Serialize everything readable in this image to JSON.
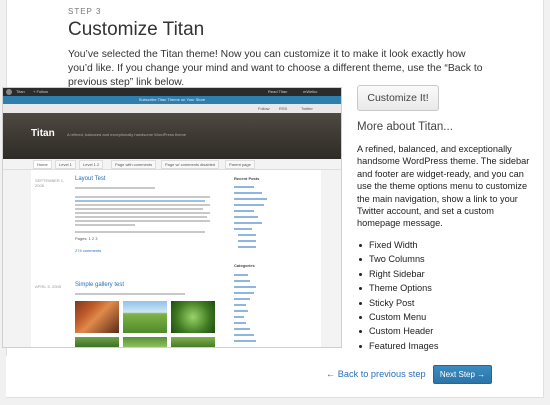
{
  "step": {
    "label": "STEP 3"
  },
  "title": "Customize Titan",
  "intro": "You’ve selected the Titan theme! Now you can customize it to make it look exactly how you’d like. If you change your mind and want to choose a different theme, use the “Back to previous step” link below.",
  "preview": {
    "adminbar": {
      "site": "Titan",
      "new": "+ Follow",
      "right1": "Read Titan",
      "right2": "mWelko"
    },
    "notice": "Subscribe Titan Theme on Your Store",
    "social": [
      "Follow",
      "RSS",
      "Twitter"
    ],
    "site_name": "Titan",
    "tagline": "A refined, balanced and exceptionally handsome WordPress theme",
    "nav_tabs": [
      "Home",
      "Level 1",
      "Level 1.2",
      "Page with comments",
      "Page w/ comments disabled",
      "Parent page"
    ],
    "posts": [
      {
        "date": "SEPTEMBER 1, 2008",
        "title": "Layout Test",
        "pages_label": "Pages: 1 2 3",
        "comments": "274 comments"
      },
      {
        "date": "APRIL 5, 2008",
        "title": "Simple gallery test"
      }
    ],
    "sidebar": {
      "recent_heading": "Recent Posts",
      "categories_heading": "Categories"
    }
  },
  "customize_button": "Customize It!",
  "more_heading": "More about Titan...",
  "description": "A refined, balanced, and exceptionally handsome WordPress theme. The sidebar and footer are widget-ready, and you can use the theme options menu to customize the main navigation, show a link to your Twitter account, and set a custom homepage message.",
  "features": [
    "Fixed Width",
    "Two Columns",
    "Right Sidebar",
    "Theme Options",
    "Sticky Post",
    "Custom Menu",
    "Custom Header",
    "Featured Images"
  ],
  "footer": {
    "back_label": "← Back to previous step",
    "next_label": "Next Step →"
  },
  "colors": {
    "link": "#2a6ebb",
    "primary_button": "#2b74a8"
  }
}
